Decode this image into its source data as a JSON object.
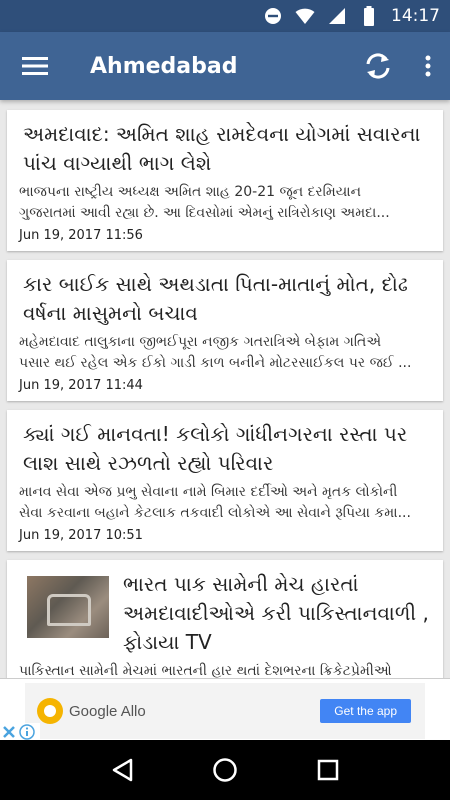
{
  "status_bar": {
    "time": "14:17",
    "icons": [
      "do-not-disturb-icon",
      "wifi-icon",
      "signal-icon",
      "battery-icon"
    ]
  },
  "app_bar": {
    "title": "Ahmedabad",
    "icons": [
      "menu-icon",
      "refresh-icon",
      "more-vert-icon"
    ]
  },
  "colors": {
    "status_bar": "#2f4f7a",
    "app_bar": "#3f6494",
    "background": "#e9e9e9",
    "ad_button": "#4285f4"
  },
  "articles": [
    {
      "headline": "અમદાવાદ: અમિત શાહ રામદેવના યોગમાં સવારના પાંચ વાગ્યાથી ભાગ લેશે",
      "summary_1": "ભાજપના રાષ્ટ્રીય અધ્યક્ષ અમિત શાહ 20-21 જૂન દરમિયાન",
      "summary_2": "ગુજરાતમાં આવી રહ્યા છે. આ દિવસોમાં એમનું રાત્રિરોકાણ અમદા...",
      "date": "Jun 19, 2017 11:56"
    },
    {
      "headline": "કાર બાઈક સાથે અથડાતા પિતા-માતાનું મોત, દોઢ વર્ષના માસુમનો બચાવ",
      "summary_1": "મહેમદાવાદ તાલુકાના જીભઈપૂરા નજીક ગતરાત્રિએ બેફામ ગતિએ",
      "summary_2": "પસાર થઈ રહેલ એક ઈકો ગાડી કાળ બનીને મોટરસાઈકલ પર જઈ ...",
      "date": "Jun 19, 2017 11:44"
    },
    {
      "headline": "ક્યાં ગઈ માનવતા! કલોકો ગાંધીનગરના રસ્તા પર લાશ સાથે રઝળતો રહ્યો પરિવાર",
      "summary_1": "માનવ સેવા એજ પ્રભુ સેવાના નામે બિમાર દર્દીઓ અને મૃતક લોકોની",
      "summary_2": "સેવા કરવાના બહાને કેટલાક તકવાદી લોકોએ આ સેવાને રૂપિયા કમા...",
      "date": "Jun 19, 2017 10:51"
    },
    {
      "headline": "ભારત પાક સામેની મેચ હારતાં અમદાવાદીઓએ કરી પાકિસ્તાનવાળી , ફોડાયા TV",
      "summary_1": "પાકિસ્તાન સામેની મેચમાં ભારતની હાર થતાં દેશભરના ક્રિકેટપ્રેમીઓ",
      "thumbnail": "broken-tv-photo"
    }
  ],
  "ad": {
    "brand": "Google Allo",
    "cta": "Get the app"
  },
  "nav": {
    "icons": [
      "back-icon",
      "home-icon",
      "recents-icon"
    ]
  }
}
